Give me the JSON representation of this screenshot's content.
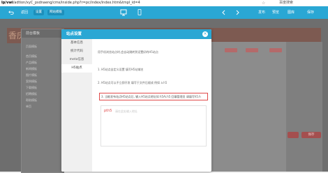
{
  "browser": {
    "url_host": "lp/vwi",
    "url_path": "adtion/xyC_psdnaeng/cms/inside.php?r=pc/index/index.htm&tmpl_id=4",
    "star": "☆",
    "bookmark": "百度搜索"
  },
  "topbar": {
    "back": "返回",
    "pill1": "设置",
    "pill2": "网站模板",
    "right_items": [
      "发布",
      "预览",
      "图库",
      "保存"
    ]
  },
  "background": {
    "header_text": "香庆",
    "panel_title": "前台模板",
    "panel_tab": "页面模板",
    "items": [
      "首页模板",
      "产品模板",
      "新闻模板",
      "图片模板",
      "案例模板",
      "下载模板",
      "招聘模板",
      "帮助模板",
      "单页"
    ],
    "save_label": "保存"
  },
  "modal": {
    "title": "站点设置",
    "close": "×",
    "nav": [
      "基本信息",
      "统计代码",
      "meta信息",
      "H5站点"
    ],
    "active_nav_index": 3,
    "intro": "用手机浏览站点时,会自动跳转到设置好的H5站点",
    "point1": "1. H5站点自定义设置 填写H5站域名",
    "point2": "2. H5站点可以不立即开发 填写于文件后缀成 例如 a.h5",
    "highlight": "3. 当能发布站点H5站点后, 输入H5站点地址如 h5Ai.h5 回填管理员 请填写h5.h",
    "textarea_prefix": "pth5",
    "textarea_placeholder": "请在此处输入地址"
  },
  "colors": {
    "topbar": "#2aa7d4",
    "modal_header": "#2aa7d4",
    "highlight_border": "#e04a4a",
    "overlay": "#6e6e6e"
  }
}
